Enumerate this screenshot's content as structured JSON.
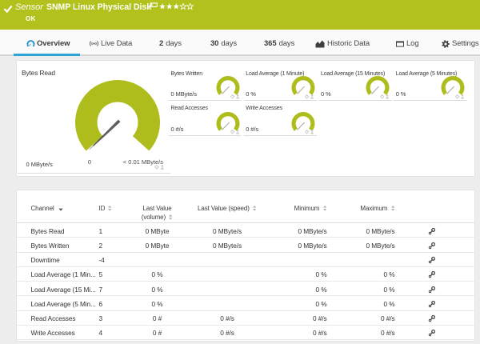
{
  "banner": {
    "kind_label": "Sensor",
    "title": "SNMP Linux Physical Disk",
    "status": "OK",
    "rating": {
      "filled_stars": 3,
      "total_stars": 5
    }
  },
  "tabs": [
    {
      "label": "Overview",
      "icon": "gauge-icon",
      "active": true
    },
    {
      "label": "Live Data",
      "icon": "broadcast-icon"
    },
    {
      "num": "2",
      "label": "days"
    },
    {
      "num": "30",
      "label": "days"
    },
    {
      "num": "365",
      "label": "days"
    },
    {
      "label": "Historic Data",
      "icon": "area-chart-icon"
    },
    {
      "label": "Log",
      "icon": "window-icon"
    },
    {
      "label": "Settings",
      "icon": "gear-icon"
    }
  ],
  "overview": {
    "primary_gauge": {
      "label": "Bytes Read",
      "value": "0 MByte/s",
      "scale_min": "0",
      "scale_max": "< 0.01 MByte/s"
    },
    "mini_gauges": [
      {
        "label": "Bytes Written",
        "value": "0 MByte/s"
      },
      {
        "label": "Load Average (1 Minute)",
        "value": "0 %"
      },
      {
        "label": "Load Average (15 Minutes)",
        "value": "0 %"
      },
      {
        "label": "Load Average (5 Minutes)",
        "value": "0 %"
      },
      {
        "label": "Read Accesses",
        "value": "0 #/s"
      },
      {
        "label": "Write Accesses",
        "value": "0 #/s"
      }
    ]
  },
  "table": {
    "columns": {
      "channel": "Channel",
      "id": "ID",
      "volume_line1": "Last Value",
      "volume_line2": "(volume)",
      "speed": "Last Value (speed)",
      "min": "Minimum",
      "max": "Maximum"
    },
    "rows": [
      {
        "channel": "Bytes Read",
        "id": "1",
        "volume": "0 MByte",
        "speed": "0 MByte/s",
        "min": "0 MByte/s",
        "max": "0 MByte/s"
      },
      {
        "channel": "Bytes Written",
        "id": "2",
        "volume": "0 MByte",
        "speed": "0 MByte/s",
        "min": "0 MByte/s",
        "max": "0 MByte/s"
      },
      {
        "channel": "Downtime",
        "id": "-4",
        "volume": "",
        "speed": "",
        "min": "",
        "max": ""
      },
      {
        "channel": "Load Average (1 Min...",
        "id": "5",
        "volume": "0 %",
        "speed": "",
        "min": "0 %",
        "max": "0 %"
      },
      {
        "channel": "Load Average (15 Mi...",
        "id": "7",
        "volume": "0 %",
        "speed": "",
        "min": "0 %",
        "max": "0 %"
      },
      {
        "channel": "Load Average (5 Min...",
        "id": "6",
        "volume": "0 %",
        "speed": "",
        "min": "0 %",
        "max": "0 %"
      },
      {
        "channel": "Read Accesses",
        "id": "3",
        "volume": "0 #",
        "speed": "0 #/s",
        "min": "0 #/s",
        "max": "0 #/s"
      },
      {
        "channel": "Write Accesses",
        "id": "4",
        "volume": "0 #",
        "speed": "0 #/s",
        "min": "0 #/s",
        "max": "0 #/s"
      }
    ]
  },
  "colors": {
    "banner_green": "#b3c11c",
    "gauge_green": "#aebd1b",
    "accent_blue": "#2ea3d6"
  }
}
